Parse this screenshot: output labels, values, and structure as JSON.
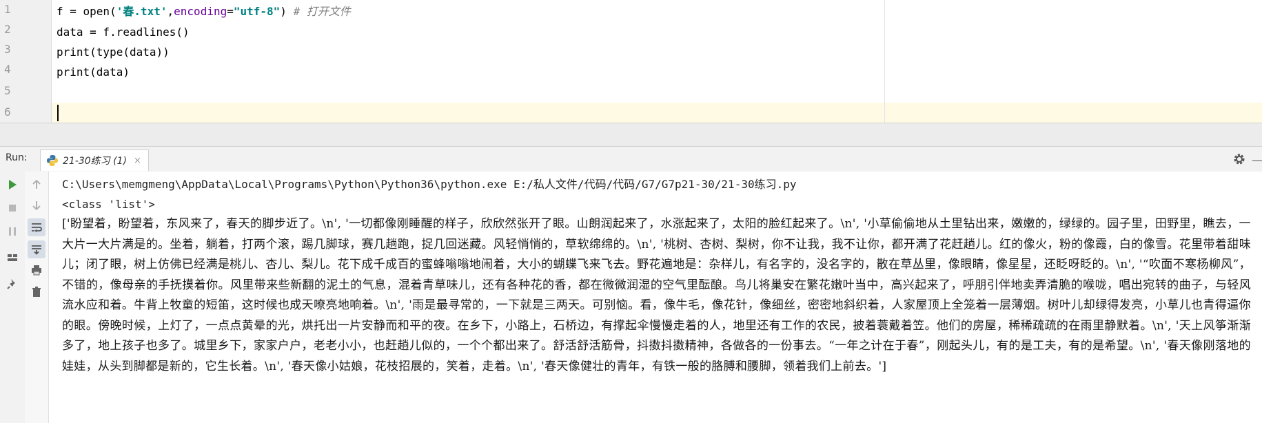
{
  "editor": {
    "line_numbers": [
      "1",
      "2",
      "3",
      "4",
      "5",
      "6"
    ],
    "lines": [
      {
        "pre": "f = open(",
        "str1": "'春.txt'",
        "mid": ",",
        "kw": "encoding",
        "eq": "=",
        "str2": "\"utf-8\"",
        "post": ")",
        "comment": " # 打开文件"
      },
      {
        "text": "data = f.readlines()"
      },
      {
        "text": "print(type(data))"
      },
      {
        "text": "print(data)"
      },
      {
        "text": ""
      },
      {
        "text": ""
      }
    ]
  },
  "run_panel": {
    "label": "Run:",
    "tab_label": "21-30练习 (1)",
    "tab_close": "×",
    "toolbar": {
      "run": "run-icon",
      "stop": "stop-icon",
      "pause": "pause-icon",
      "layout": "layout-icon",
      "pin": "pin-icon",
      "up": "arrow-up-icon",
      "down": "arrow-down-icon",
      "soft_wrap": "soft-wrap-icon",
      "scroll_end": "scroll-to-end-icon",
      "print": "print-icon",
      "trash": "trash-icon"
    }
  },
  "console": {
    "command": "C:\\Users\\memgmeng\\AppData\\Local\\Programs\\Python\\Python36\\python.exe E:/私人文件/代码/代码/G7/G7p21-30/21-30练习.py",
    "type_output": "<class 'list'>",
    "list_output": "['盼望着，盼望着，东风来了，春天的脚步近了。\\n', '一切都像刚睡醒的样子，欣欣然张开了眼。山朗润起来了，水涨起来了，太阳的脸红起来了。\\n', '小草偷偷地从土里钻出来，嫩嫩的，绿绿的。园子里，田野里，瞧去，一大片一大片满是的。坐着，躺着，打两个滚，踢几脚球，赛几趟跑，捉几回迷藏。风轻悄悄的，草软绵绵的。\\n', '桃树、杏树、梨树，你不让我，我不让你，都开满了花赶趟儿。红的像火，粉的像霞，白的像雪。花里带着甜味儿；闭了眼，树上仿佛已经满是桃儿、杏儿、梨儿。花下成千成百的蜜蜂嗡嗡地闹着，大小的蝴蝶飞来飞去。野花遍地是：杂样儿，有名字的，没名字的，散在草丛里，像眼睛，像星星，还眨呀眨的。\\n', '“吹面不寒杨柳风”，不错的，像母亲的手抚摸着你。风里带来些新翻的泥土的气息，混着青草味儿，还有各种花的香，都在微微润湿的空气里酝酿。鸟儿将巢安在繁花嫩叶当中，高兴起来了，呼朋引伴地卖弄清脆的喉咙，唱出宛转的曲子，与轻风流水应和着。牛背上牧童的短笛，这时候也成天嘹亮地响着。\\n', '雨是最寻常的，一下就是三两天。可别恼。看，像牛毛，像花针，像细丝，密密地斜织着，人家屋顶上全笼着一层薄烟。树叶儿却绿得发亮，小草儿也青得逼你的眼。傍晚时候，上灯了，一点点黄晕的光，烘托出一片安静而和平的夜。在乡下，小路上，石桥边，有撑起伞慢慢走着的人，地里还有工作的农民，披着蓑戴着笠。他们的房屋，稀稀疏疏的在雨里静默着。\\n', '天上风筝渐渐多了，地上孩子也多了。城里乡下，家家户户，老老小小，也赶趟儿似的，一个个都出来了。舒活舒活筋骨，抖擞抖擞精神，各做各的一份事去。“一年之计在于春”，刚起头儿，有的是工夫，有的是希望。\\n', '春天像刚落地的娃娃，从头到脚都是新的，它生长着。\\n', '春天像小姑娘，花枝招展的，笑着，走着。\\n', '春天像健壮的青年，有铁一般的胳膊和腰脚，领着我们上前去。']"
  },
  "colors": {
    "string": "#008080",
    "comment": "#808080",
    "keyword_arg": "#660099",
    "caret_row": "#fffae3",
    "run_green": "#3c9a3c"
  }
}
